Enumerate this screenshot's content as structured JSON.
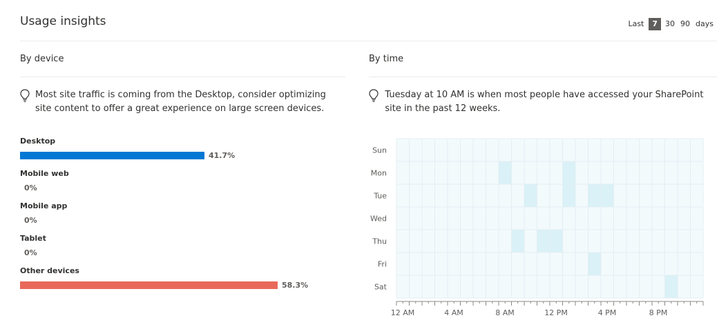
{
  "header": {
    "title": "Usage insights",
    "range_label": "Last",
    "range_options": [
      "7",
      "30",
      "90"
    ],
    "range_selected": "7",
    "range_suffix": "days"
  },
  "by_device": {
    "title": "By device",
    "insight": "Most site traffic is coming from the Desktop, consider optimizing site content to offer a great experience on large screen devices.",
    "items": [
      {
        "name": "Desktop",
        "value": "41.7%",
        "fraction": 0.417,
        "color": "#0078d4"
      },
      {
        "name": "Mobile web",
        "value": "0%",
        "fraction": 0,
        "color": "#0078d4"
      },
      {
        "name": "Mobile app",
        "value": "0%",
        "fraction": 0,
        "color": "#0078d4"
      },
      {
        "name": "Tablet",
        "value": "0%",
        "fraction": 0,
        "color": "#0078d4"
      },
      {
        "name": "Other devices",
        "value": "58.3%",
        "fraction": 0.583,
        "color": "#e8695a"
      }
    ]
  },
  "by_time": {
    "title": "By time",
    "insight": "Tuesday at 10 AM is when most people have accessed your SharePoint site in the past 12 weeks.",
    "chart_data": {
      "type": "heatmap",
      "days": [
        "Sun",
        "Mon",
        "Tue",
        "Wed",
        "Thu",
        "Fri",
        "Sat"
      ],
      "hours": 24,
      "x_tick_labels": [
        {
          "hour": 0,
          "label": "12 AM"
        },
        {
          "hour": 4,
          "label": "4 AM"
        },
        {
          "hour": 8,
          "label": "8 AM"
        },
        {
          "hour": 12,
          "label": "12 PM"
        },
        {
          "hour": 16,
          "label": "4 PM"
        },
        {
          "hour": 20,
          "label": "8 PM"
        }
      ],
      "active_cells": [
        {
          "day": "Mon",
          "hour": 8
        },
        {
          "day": "Mon",
          "hour": 13
        },
        {
          "day": "Tue",
          "hour": 10
        },
        {
          "day": "Tue",
          "hour": 13
        },
        {
          "day": "Tue",
          "hour": 15
        },
        {
          "day": "Tue",
          "hour": 16
        },
        {
          "day": "Thu",
          "hour": 9
        },
        {
          "day": "Thu",
          "hour": 11
        },
        {
          "day": "Thu",
          "hour": 12
        },
        {
          "day": "Fri",
          "hour": 15
        },
        {
          "day": "Sat",
          "hour": 21
        }
      ],
      "base_color": "#f3fafc",
      "active_color": "#d9f1f7",
      "grid_color": "#e3eff3"
    }
  }
}
